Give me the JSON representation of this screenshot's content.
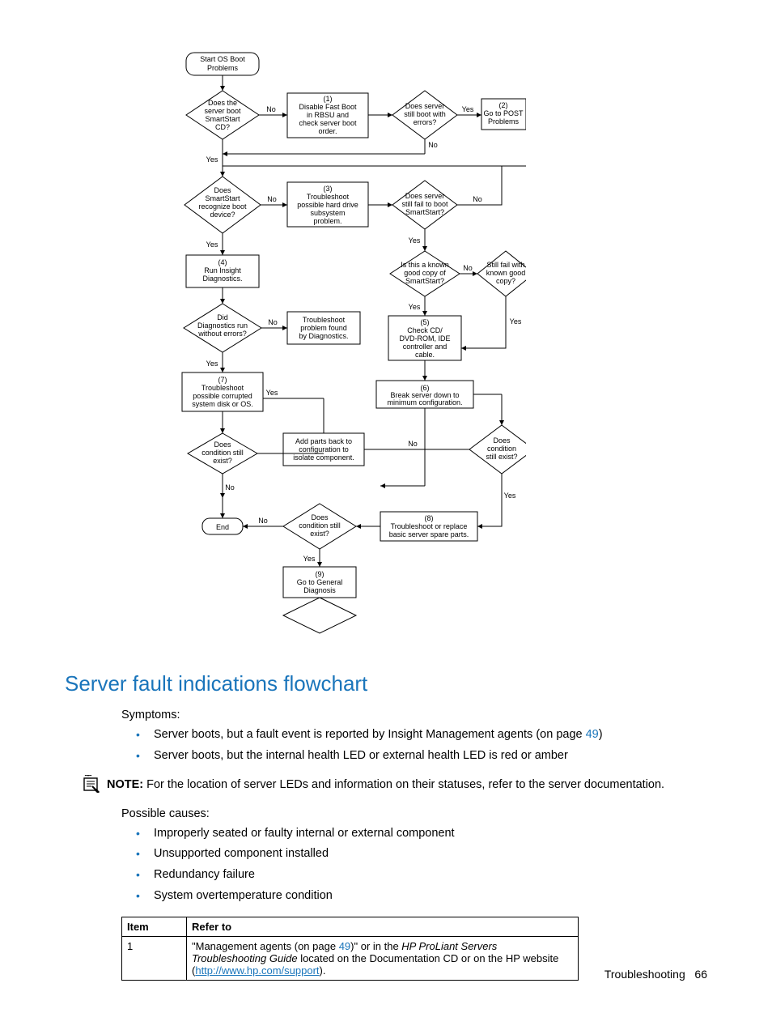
{
  "flowchart": {
    "start": {
      "l1": "Start OS Boot",
      "l2": "Problems"
    },
    "d_boot_cd": {
      "l1": "Does the",
      "l2": "server boot",
      "l3": "SmartStart",
      "l4": "CD?"
    },
    "p1": {
      "l0": "(1)",
      "l1": "Disable Fast Boot",
      "l2": "in RBSU and",
      "l3": "check server boot",
      "l4": "order."
    },
    "d_errors": {
      "l1": "Does server",
      "l2": "still boot with",
      "l3": "errors?"
    },
    "p2": {
      "l0": "(2)",
      "l1": "Go to POST",
      "l2": "Problems"
    },
    "d_recog": {
      "l1": "Does",
      "l2": "SmartStart",
      "l3": "recognize boot",
      "l4": "device?"
    },
    "p3": {
      "l0": "(3)",
      "l1": "Troubleshoot",
      "l2": "possible hard drive",
      "l3": "subsystem",
      "l4": "problem."
    },
    "d_failboot": {
      "l1": "Does server",
      "l2": "still fail to boot",
      "l3": "SmartStart?"
    },
    "p4": {
      "l0": "(4)",
      "l1": "Run Insight",
      "l2": "Diagnostics."
    },
    "d_known": {
      "l1": "Is this a known",
      "l2": "good copy of",
      "l3": "SmartStart?"
    },
    "d_knowncopy": {
      "l1": "Still fail with",
      "l2": "known good",
      "l3": "copy?"
    },
    "d_diag": {
      "l1": "Did",
      "l2": "Diagnostics run",
      "l3": "without errors?"
    },
    "p_diagfound": {
      "l1": "Troubleshoot",
      "l2": "problem found",
      "l3": "by Diagnostics."
    },
    "p5": {
      "l0": "(5)",
      "l1": "Check CD/",
      "l2": "DVD-ROM, IDE",
      "l3": "controller and",
      "l4": "cable."
    },
    "p7": {
      "l0": "(7)",
      "l1": "Troubleshoot",
      "l2": "possible corrupted",
      "l3": "system disk or OS."
    },
    "p6": {
      "l0": "(6)",
      "l1": "Break server down to",
      "l2": "minimum configuration."
    },
    "p_addparts": {
      "l1": "Add parts back to",
      "l2": "configuration to",
      "l3": "isolate component."
    },
    "d_cond1": {
      "l1": "Does",
      "l2": "condition still",
      "l3": "exist?"
    },
    "d_cond2": {
      "l1": "Does",
      "l2": "condition still",
      "l3": "exist?"
    },
    "d_cond3": {
      "l1": "Does",
      "l2": "condition",
      "l3": "still exist?"
    },
    "p8": {
      "l0": "(8)",
      "l1": "Troubleshoot or replace",
      "l2": "basic server spare parts."
    },
    "end": {
      "l1": "End"
    },
    "p9": {
      "l0": "(9)",
      "l1": "Go to General",
      "l2": "Diagnosis"
    },
    "labels": {
      "yes": "Yes",
      "no": "No"
    }
  },
  "heading": "Server fault indications flowchart",
  "symptoms_label": "Symptoms:",
  "symptoms": {
    "s1a": "Server boots, but a fault event is reported by Insight Management agents (on page ",
    "s1link": "49",
    "s1b": ")",
    "s2": "Server boots, but the internal health LED or external health LED is red or amber"
  },
  "note_prefix": "NOTE:",
  "note_body": "  For the location of server LEDs and information on their statuses, refer to the server documentation.",
  "causes_label": "Possible causes:",
  "causes": {
    "c1": "Improperly seated or faulty internal or external component",
    "c2": "Unsupported component installed",
    "c3": "Redundancy failure",
    "c4": "System overtemperature condition"
  },
  "table": {
    "h1": "Item",
    "h2": "Refer to",
    "r1_item": "1",
    "r1_a": "\"Management agents (on page ",
    "r1_link": "49",
    "r1_b": ")\" or in the ",
    "r1_i": "HP ProLiant Servers Troubleshooting Guide",
    "r1_c": " located on the Documentation CD or on the HP website (",
    "r1_url": "http://www.hp.com/support",
    "r1_d": ")."
  },
  "footer": {
    "section": "Troubleshooting",
    "page": "66"
  }
}
